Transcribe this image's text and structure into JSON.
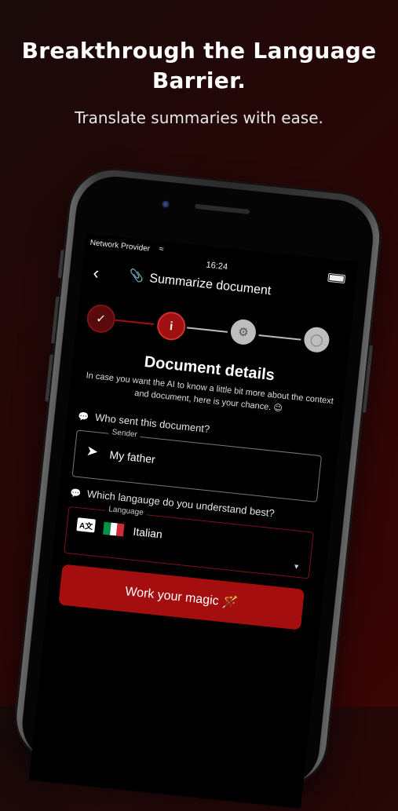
{
  "hero": {
    "title": "Breakthrough the Language Barrier.",
    "subtitle": "Translate summaries with ease."
  },
  "status_bar": {
    "provider": "Network Provider",
    "time": "16:24"
  },
  "app_bar": {
    "back_icon": "chevron-left-icon",
    "title_icon": "document-icon",
    "title": "Summarize document"
  },
  "stepper": {
    "steps": [
      {
        "icon": "check-icon",
        "state": "done"
      },
      {
        "icon": "info-icon",
        "state": "active"
      },
      {
        "icon": "gears-icon",
        "state": "pending"
      },
      {
        "icon": "lightbulb-icon",
        "state": "pending"
      }
    ]
  },
  "section": {
    "title": "Document details",
    "description": "In case you want the AI to know a little bit more about the context and document, here is your chance. 😉"
  },
  "sender": {
    "question": "Who sent this document?",
    "label": "Sender",
    "value": "My father"
  },
  "language": {
    "question": "Which langauge do you understand best?",
    "label": "Language",
    "value": "Italian",
    "flag_colors": [
      "#009246",
      "#ffffff",
      "#ce2b37"
    ]
  },
  "cta": {
    "label": "Work your magic 🪄"
  },
  "colors": {
    "accent": "#a50e0e",
    "accent_dark": "#5a0a0a",
    "pending": "#bdbdbd"
  }
}
